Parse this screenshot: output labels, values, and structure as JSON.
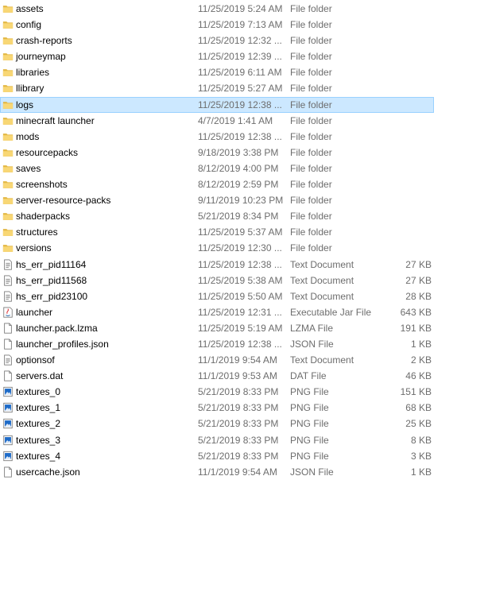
{
  "colors": {
    "folder": "#f8d775",
    "folder_dark": "#e3b743",
    "selection_bg": "#cce8ff",
    "selection_border": "#99d1ff",
    "meta_text": "#6d6d6d",
    "image_blue": "#1e6bc8"
  },
  "rows": [
    {
      "name": "assets",
      "date": "11/25/2019 5:24 AM",
      "type": "File folder",
      "size": "",
      "icon": "folder-icon"
    },
    {
      "name": "config",
      "date": "11/25/2019 7:13 AM",
      "type": "File folder",
      "size": "",
      "icon": "folder-icon"
    },
    {
      "name": "crash-reports",
      "date": "11/25/2019 12:32 ...",
      "type": "File folder",
      "size": "",
      "icon": "folder-icon"
    },
    {
      "name": "journeymap",
      "date": "11/25/2019 12:39 ...",
      "type": "File folder",
      "size": "",
      "icon": "folder-icon"
    },
    {
      "name": "libraries",
      "date": "11/25/2019 6:11 AM",
      "type": "File folder",
      "size": "",
      "icon": "folder-icon"
    },
    {
      "name": "llibrary",
      "date": "11/25/2019 5:27 AM",
      "type": "File folder",
      "size": "",
      "icon": "folder-icon"
    },
    {
      "name": "logs",
      "date": "11/25/2019 12:38 ...",
      "type": "File folder",
      "size": "",
      "icon": "folder-icon",
      "selected": true
    },
    {
      "name": "minecraft launcher",
      "date": "4/7/2019 1:41 AM",
      "type": "File folder",
      "size": "",
      "icon": "folder-icon"
    },
    {
      "name": "mods",
      "date": "11/25/2019 12:38 ...",
      "type": "File folder",
      "size": "",
      "icon": "folder-icon"
    },
    {
      "name": "resourcepacks",
      "date": "9/18/2019 3:38 PM",
      "type": "File folder",
      "size": "",
      "icon": "folder-icon"
    },
    {
      "name": "saves",
      "date": "8/12/2019 4:00 PM",
      "type": "File folder",
      "size": "",
      "icon": "folder-icon"
    },
    {
      "name": "screenshots",
      "date": "8/12/2019 2:59 PM",
      "type": "File folder",
      "size": "",
      "icon": "folder-icon"
    },
    {
      "name": "server-resource-packs",
      "date": "9/11/2019 10:23 PM",
      "type": "File folder",
      "size": "",
      "icon": "folder-icon"
    },
    {
      "name": "shaderpacks",
      "date": "5/21/2019 8:34 PM",
      "type": "File folder",
      "size": "",
      "icon": "folder-icon"
    },
    {
      "name": "structures",
      "date": "11/25/2019 5:37 AM",
      "type": "File folder",
      "size": "",
      "icon": "folder-icon"
    },
    {
      "name": "versions",
      "date": "11/25/2019 12:30 ...",
      "type": "File folder",
      "size": "",
      "icon": "folder-icon"
    },
    {
      "name": "hs_err_pid11164",
      "date": "11/25/2019 12:38 ...",
      "type": "Text Document",
      "size": "27 KB",
      "icon": "text-document-icon"
    },
    {
      "name": "hs_err_pid11568",
      "date": "11/25/2019 5:38 AM",
      "type": "Text Document",
      "size": "27 KB",
      "icon": "text-document-icon"
    },
    {
      "name": "hs_err_pid23100",
      "date": "11/25/2019 5:50 AM",
      "type": "Text Document",
      "size": "28 KB",
      "icon": "text-document-icon"
    },
    {
      "name": "launcher",
      "date": "11/25/2019 12:31 ...",
      "type": "Executable Jar File",
      "size": "643 KB",
      "icon": "java-jar-icon"
    },
    {
      "name": "launcher.pack.lzma",
      "date": "11/25/2019 5:19 AM",
      "type": "LZMA File",
      "size": "191 KB",
      "icon": "blank-file-icon"
    },
    {
      "name": "launcher_profiles.json",
      "date": "11/25/2019 12:38 ...",
      "type": "JSON File",
      "size": "1 KB",
      "icon": "blank-file-icon"
    },
    {
      "name": "optionsof",
      "date": "11/1/2019 9:54 AM",
      "type": "Text Document",
      "size": "2 KB",
      "icon": "text-document-icon"
    },
    {
      "name": "servers.dat",
      "date": "11/1/2019 9:53 AM",
      "type": "DAT File",
      "size": "46 KB",
      "icon": "blank-file-icon"
    },
    {
      "name": "textures_0",
      "date": "5/21/2019 8:33 PM",
      "type": "PNG File",
      "size": "151 KB",
      "icon": "png-image-icon"
    },
    {
      "name": "textures_1",
      "date": "5/21/2019 8:33 PM",
      "type": "PNG File",
      "size": "68 KB",
      "icon": "png-image-icon"
    },
    {
      "name": "textures_2",
      "date": "5/21/2019 8:33 PM",
      "type": "PNG File",
      "size": "25 KB",
      "icon": "png-image-icon"
    },
    {
      "name": "textures_3",
      "date": "5/21/2019 8:33 PM",
      "type": "PNG File",
      "size": "8 KB",
      "icon": "png-image-icon"
    },
    {
      "name": "textures_4",
      "date": "5/21/2019 8:33 PM",
      "type": "PNG File",
      "size": "3 KB",
      "icon": "png-image-icon"
    },
    {
      "name": "usercache.json",
      "date": "11/1/2019 9:54 AM",
      "type": "JSON File",
      "size": "1 KB",
      "icon": "blank-file-icon"
    }
  ]
}
